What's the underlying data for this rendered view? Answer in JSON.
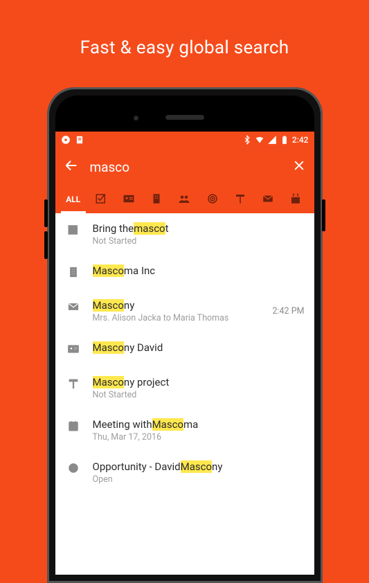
{
  "hero": {
    "title": "Fast & easy global search"
  },
  "statusbar": {
    "time": "2:42"
  },
  "search": {
    "query": "masco"
  },
  "tabs": {
    "all_label": "ALL"
  },
  "results": [
    {
      "icon": "task",
      "pre": "Bring the ",
      "hl": "masco",
      "post": "t",
      "sub": "Not Started"
    },
    {
      "icon": "building",
      "pre": "",
      "hl": "Masco",
      "post": "ma Inc",
      "sub": ""
    },
    {
      "icon": "mail",
      "pre": "",
      "hl": "Masco",
      "post": "ny",
      "sub": "Mrs. Alison Jacka to Maria Thomas",
      "time": "2:42 PM"
    },
    {
      "icon": "contact",
      "pre": "",
      "hl": "Masco",
      "post": "ny David",
      "sub": ""
    },
    {
      "icon": "project",
      "pre": "",
      "hl": "Masco",
      "post": "ny project",
      "sub": "Not Started"
    },
    {
      "icon": "calendar",
      "pre": "Meeting with ",
      "hl": "Masco",
      "post": "ma",
      "sub": "Thu, Mar 17, 2016"
    },
    {
      "icon": "opportunity",
      "pre": "Opportunity - David ",
      "hl": "Masco",
      "post": "ny",
      "sub": "Open"
    }
  ]
}
